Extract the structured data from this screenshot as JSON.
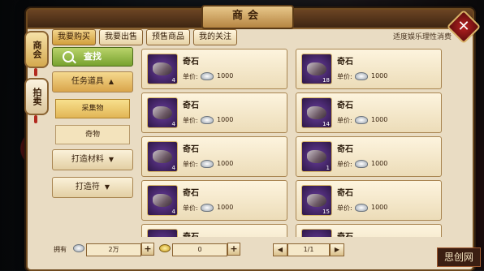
{
  "window": {
    "title": "商会"
  },
  "side_tabs": [
    {
      "label": "商会",
      "active": true
    },
    {
      "label": "拍卖",
      "active": false
    }
  ],
  "close_label": "✕",
  "tabs": [
    {
      "label": "我要购买",
      "active": true
    },
    {
      "label": "我要出售",
      "active": false
    },
    {
      "label": "预售商品",
      "active": false
    },
    {
      "label": "我的关注",
      "active": false
    }
  ],
  "motto": "适度娱乐理性消费",
  "search_label": "查找",
  "categories": {
    "task_items": "任务道具",
    "sub_gather": "采集物",
    "sub_rare": "奇物",
    "forge_materials": "打造材料",
    "forge_charm": "打造符"
  },
  "chev": {
    "up": "▲",
    "down": "▼"
  },
  "items": [
    {
      "name": "奇石",
      "qty": "4",
      "price_label": "单价:",
      "price": "1000"
    },
    {
      "name": "奇石",
      "qty": "18",
      "price_label": "单价:",
      "price": "1000"
    },
    {
      "name": "奇石",
      "qty": "4",
      "price_label": "单价:",
      "price": "1000"
    },
    {
      "name": "奇石",
      "qty": "14",
      "price_label": "单价:",
      "price": "1000"
    },
    {
      "name": "奇石",
      "qty": "4",
      "price_label": "单价:",
      "price": "1000"
    },
    {
      "name": "奇石",
      "qty": "1",
      "price_label": "单价:",
      "price": "1000"
    },
    {
      "name": "奇石",
      "qty": "4",
      "price_label": "单价:",
      "price": "1000"
    },
    {
      "name": "奇石",
      "qty": "15",
      "price_label": "单价:",
      "price": "1000"
    },
    {
      "name": "奇石",
      "qty": "",
      "price_label": "",
      "price": ""
    },
    {
      "name": "奇石",
      "qty": "",
      "price_label": "",
      "price": ""
    }
  ],
  "bottom": {
    "owned_label": "拥有",
    "silver_amount": "2万",
    "gold_amount": "0",
    "page": "1/1",
    "prev": "◀",
    "next": "▶",
    "plus": "+"
  },
  "watermark": "思创网"
}
